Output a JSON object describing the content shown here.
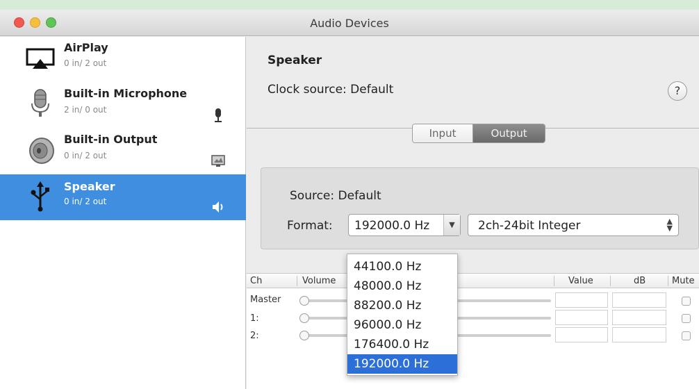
{
  "window": {
    "title": "Audio Devices"
  },
  "devices": [
    {
      "name": "AirPlay",
      "io": "0 in/ 2 out",
      "icon": "airplay-icon",
      "badge": ""
    },
    {
      "name": "Built-in Microphone",
      "io": "2 in/ 0 out",
      "icon": "microphone-icon",
      "badge": "microphone-badge-icon"
    },
    {
      "name": "Built-in Output",
      "io": "0 in/ 2 out",
      "icon": "speaker-cone-icon",
      "badge": "display-badge-icon"
    },
    {
      "name": "Speaker",
      "io": "0 in/ 2 out",
      "icon": "usb-icon",
      "badge": "speaker-volume-icon",
      "selected": true
    }
  ],
  "detail": {
    "device_name": "Speaker",
    "clock_source": "Clock source: Default",
    "help_label": "?",
    "tabs": [
      "Input",
      "Output"
    ],
    "active_tab": "Output",
    "source": "Source: Default",
    "format_label": "Format:",
    "sample_rate": "192000.0 Hz",
    "bit_format": "2ch-24bit Integer"
  },
  "table": {
    "headers": {
      "ch": "Ch",
      "volume": "Volume",
      "value": "Value",
      "db": "dB",
      "mute": "Mute"
    },
    "rows": [
      "Master",
      "1:",
      "2:"
    ]
  },
  "rate_menu": {
    "options": [
      "44100.0 Hz",
      "48000.0 Hz",
      "88200.0 Hz",
      "96000.0 Hz",
      "176400.0 Hz",
      "192000.0 Hz"
    ],
    "selected": "192000.0 Hz"
  },
  "colors": {
    "selection": "#3f8ee0",
    "menu_highlight": "#2d6fd8"
  }
}
